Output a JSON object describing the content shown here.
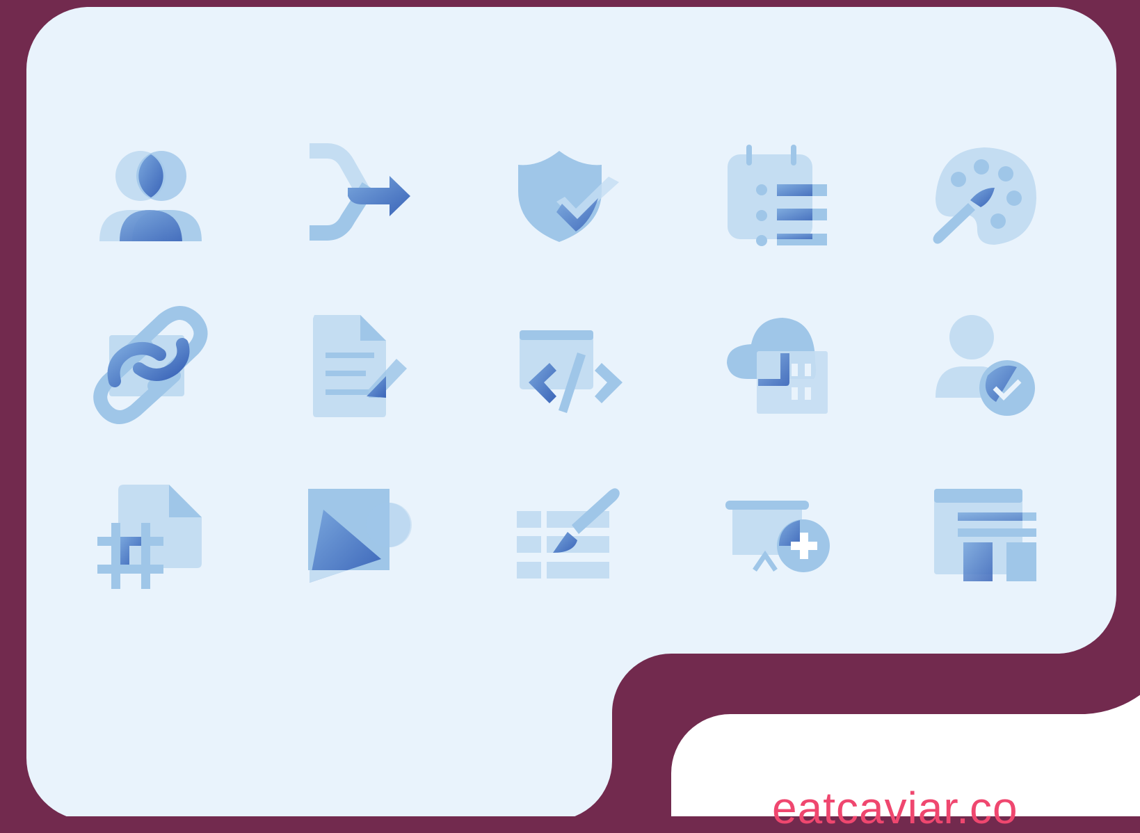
{
  "colors": {
    "background": "#722a4e",
    "panel": "#e9f3fc",
    "white": "#ffffff",
    "icon_light": "#c4ddf2",
    "icon_mid": "#9fc6e8",
    "icon_dark": "#3f6cbd",
    "brand_text": "#ef476f"
  },
  "footer": {
    "brand_text": "eatcaviar.co"
  },
  "icons": [
    "people-merge-icon",
    "merge-arrow-icon",
    "shield-check-icon",
    "calendar-list-icon",
    "palette-brush-icon",
    "link-chain-icon",
    "document-edit-icon",
    "code-window-icon",
    "cloud-building-icon",
    "user-verified-icon",
    "hashtag-file-icon",
    "shapes-icon",
    "table-brush-icon",
    "presentation-add-icon",
    "layout-template-icon"
  ]
}
